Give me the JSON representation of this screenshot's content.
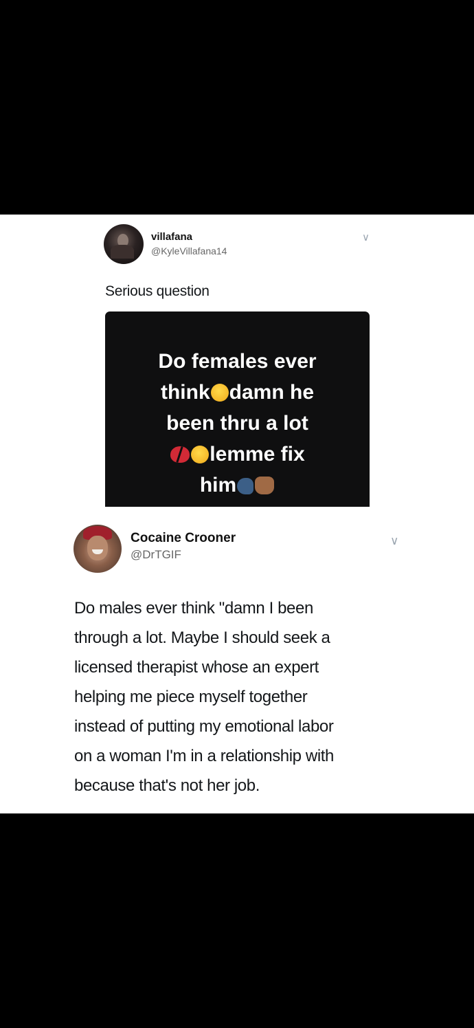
{
  "tweet1": {
    "display_name": "villafana",
    "handle": "@KyleVillafana14",
    "text": "Serious question",
    "image_lines": [
      [
        "Do females ever"
      ],
      [
        "think",
        "thinking-face-emoji",
        "damn he"
      ],
      [
        "been thru a lot"
      ],
      [
        "broken-heart-emoji",
        "pensive-face-emoji",
        "lemme fix"
      ],
      [
        "him",
        "speaking-head-emoji",
        "raised-fist-emoji"
      ]
    ],
    "image_words": {
      "line1": "Do females ever",
      "line2a": "think",
      "line2b": "damn he",
      "line3": "been thru a lot",
      "line4": "lemme fix",
      "line5": "him"
    }
  },
  "tweet2": {
    "display_name": "Cocaine Crooner",
    "handle": "@DrTGIF",
    "lines": [
      "Do males ever think \"damn I been",
      "through a lot. Maybe I should seek a",
      "licensed therapist whose an expert",
      "helping me piece myself together",
      "instead of putting my emotional labor",
      "on a woman I'm in a relationship with",
      "because that's not her job."
    ]
  },
  "icons": {
    "more_menu": "chevron-down-icon"
  },
  "colors": {
    "background": "#000000",
    "card": "#ffffff",
    "media_background": "#0f0f10",
    "handle_text": "#666666"
  }
}
